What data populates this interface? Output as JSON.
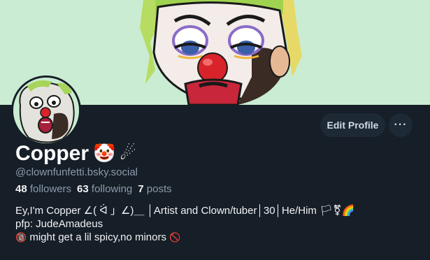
{
  "profile": {
    "name": "Copper",
    "name_emojis": [
      "🤡",
      "☄"
    ],
    "handle": "@clownfunfetti.bsky.social",
    "followers_count": "48",
    "followers_label": "followers",
    "following_count": "63",
    "following_label": "following",
    "posts_count": "7",
    "posts_label": "posts"
  },
  "actions": {
    "edit_profile_label": "Edit Profile",
    "more_label": "···"
  },
  "bio": {
    "line1": "Ey,I'm Copper ∠( ᐛ 」∠)＿ │Artist and Clown/tuber│30│He/Him 🏳⚧🌈",
    "line2": "pfp: JudeAmadeus",
    "line3_icon": "🔞",
    "line3_text": " might get a lil spicy,no minors ",
    "line3_trailing_icon": "🚫"
  },
  "colors": {
    "background": "#161e27",
    "banner": "#c9ecd2",
    "button_bg": "#1e2936",
    "muted_text": "#8c9aab",
    "clown_nose": "#d8232a"
  }
}
